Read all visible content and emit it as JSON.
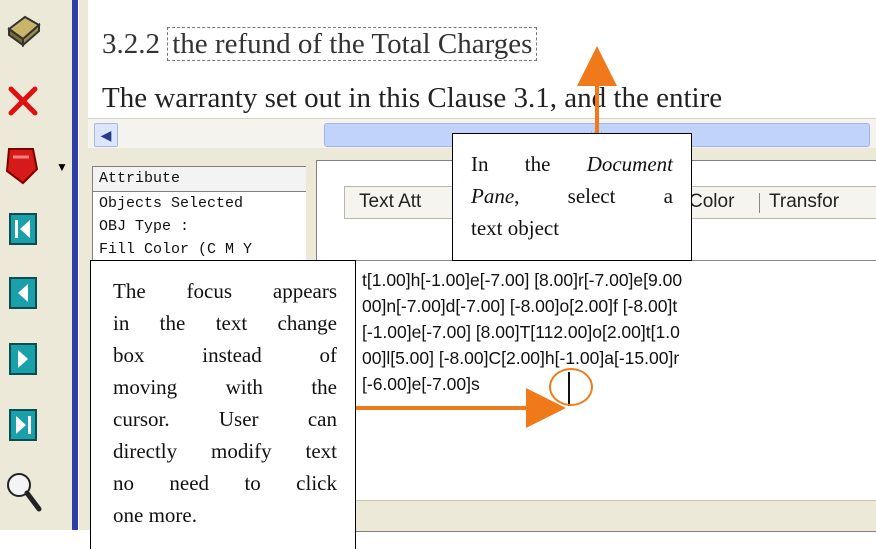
{
  "toolbar": {
    "icons": [
      "stamp-icon",
      "delete-icon",
      "flag-dropdown-icon",
      "first-page-icon",
      "previous-page-icon",
      "next-page-icon",
      "last-page-icon",
      "zoom-icon"
    ]
  },
  "document": {
    "heading_number": "3.2.2",
    "heading_selected": "the refund of the Total Charges",
    "body_text": "The warranty set out in this Clause 3.1, and the entire"
  },
  "attribute_panel": {
    "header": "Attribute",
    "rows": [
      "Objects Selected",
      "OBJ Type :",
      "Fill Color (C M Y"
    ]
  },
  "text_panel": {
    "tabs": [
      "Text Att",
      "Color",
      "Transfor"
    ],
    "edit_lines": [
      "t[1.00]h[-1.00]e[-7.00] [8.00]r[-7.00]e[9.00",
      "00]n[-7.00]d[-7.00] [-8.00]o[2.00]f [-8.00]t",
      "[-1.00]e[-7.00] [8.00]T[112.00]o[2.00]t[1.0",
      "00]l[5.00] [-8.00]C[2.00]h[-1.00]a[-15.00]r",
      "[-6.00]e[-7.00]s"
    ]
  },
  "callouts": {
    "doc_pane_prefix": "In the ",
    "doc_pane_italic": "Document Pane",
    "doc_pane_line1_a": "In the",
    "doc_pane_line1_b": "Document",
    "doc_pane_line2_a": "Pane",
    "doc_pane_line2_b": ", select a",
    "doc_pane_line3": "text object",
    "focus_lines": [
      "The focus appears",
      "in the text change",
      "box instead of",
      "moving with the",
      "cursor. User can",
      "directly modify text",
      "no need to click",
      "one more."
    ]
  },
  "colors": {
    "accent_arrow": "#f07a1a",
    "toolbar_separator": "#2f3fa6"
  }
}
